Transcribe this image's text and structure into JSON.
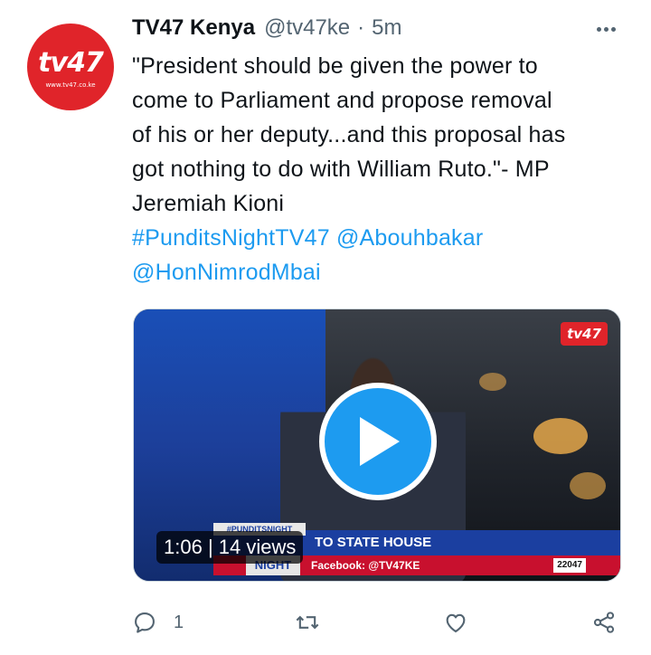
{
  "tweet": {
    "author": {
      "display_name": "TV47 Kenya",
      "handle": "@tv47ke",
      "separator": "·",
      "time": "5m",
      "avatar": {
        "logo_text": "tv47",
        "logo_url": "www.tv47.co.ke"
      }
    },
    "text_lines": [
      "\"President should be given the power to",
      "come to Parliament and propose removal",
      "of his or her deputy...and this proposal has",
      "got nothing to do with William Ruto.\"- MP",
      "Jeremiah Kioni"
    ],
    "links": {
      "hashtag": "#PunditsNightTV47",
      "mention1": "@Abouhbakar",
      "mention2": "@HonNimrodMbai"
    },
    "media": {
      "type": "video",
      "duration": "1:06",
      "views": "14 views",
      "channel_badge": "tv47",
      "lower_third": {
        "show_tag": "#PUNDITSNIGHT",
        "headline": "TO STATE HOUSE",
        "show_name": "NIGHT",
        "facebook": "Facebook: @TV47KE",
        "follower_count": "22047"
      }
    },
    "actions": {
      "reply_count": "1",
      "retweet_count": "",
      "like_count": ""
    },
    "colors": {
      "link": "#1d9bf0",
      "text": "#0f1419",
      "secondary": "#536471",
      "brand_red": "#e0242a"
    },
    "icons": [
      "more-icon",
      "reply-icon",
      "retweet-icon",
      "like-icon",
      "share-icon",
      "play-icon"
    ]
  }
}
